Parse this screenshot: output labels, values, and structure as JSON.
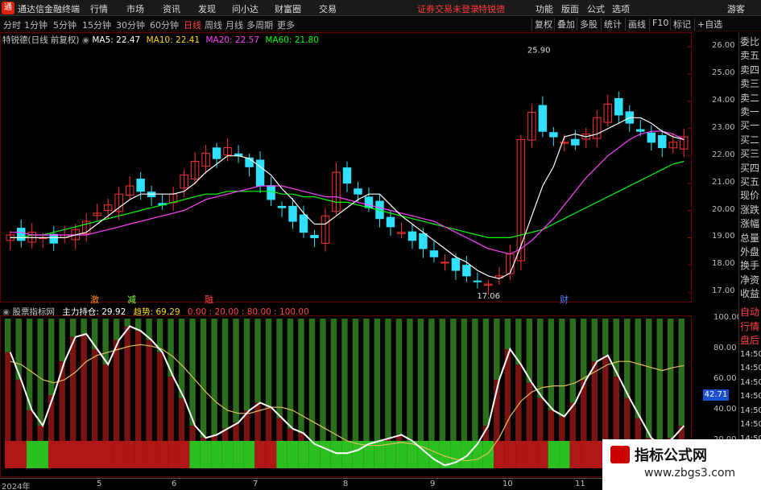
{
  "menubar": {
    "app_title": "通达信金融终端",
    "items": [
      "行情",
      "市场",
      "资讯",
      "发现",
      "问小达",
      "财富圈",
      "交易"
    ],
    "warning": "证券交易未登录",
    "stock_name": "特锐德",
    "right_items": [
      "功能",
      "版面",
      "公式",
      "选项"
    ],
    "guest": "游客",
    "logo_icon": "tdx-logo-icon"
  },
  "periodbar": {
    "periods": [
      "分时",
      "1分钟",
      "5分钟",
      "15分钟",
      "30分钟",
      "60分钟",
      "日线",
      "周线",
      "月线",
      "多周期",
      "更多"
    ],
    "active_period": "日线",
    "tools": [
      "复权",
      "叠加",
      "多股",
      "统计",
      "画线",
      "F10",
      "标记",
      "+自选"
    ]
  },
  "stockinfo": {
    "label": "特锐德(日线 前复权)",
    "ma5": "MA5: 22.47",
    "ma10": "MA10: 22.41",
    "ma20": "MA20: 22.57",
    "ma60": "MA60: 21.80",
    "colors": {
      "ma5": "#ffffff",
      "ma10": "#ffd700",
      "ma20": "#ff40ff",
      "ma60": "#00ff00"
    }
  },
  "price_axis": [
    "26.00",
    "25.00",
    "24.00",
    "23.00",
    "22.00",
    "21.00",
    "20.00",
    "19.00",
    "18.00",
    "17.00"
  ],
  "price_annotations": {
    "high": "25.90",
    "low": "17.06"
  },
  "event_markers": [
    {
      "text": "激",
      "color": "#ff8800"
    },
    {
      "text": "减",
      "color": "#88ff44"
    },
    {
      "text": "融",
      "color": "#ff4444"
    },
    {
      "text": "财",
      "color": "#4488ff"
    }
  ],
  "indicator": {
    "source": "股票指标网",
    "main_label": "主力持仓: 29.92",
    "trend_label": "趋势: 69.29",
    "levels": "0.00 : 20.00 : 80.00 : 100.00",
    "axis": [
      "100.00",
      "80.00",
      "60.00",
      "40.00",
      "20.00"
    ],
    "current_value": "42.71"
  },
  "sidebar": {
    "items": [
      "委比",
      "卖五",
      "卖四",
      "卖三",
      "卖二",
      "卖一",
      "买一",
      "买二",
      "买三",
      "买四",
      "买五",
      "现价",
      "涨跌",
      "涨幅",
      "总量",
      "外盘",
      "换手",
      "净资",
      "收益",
      "自动",
      "行情",
      "盘后",
      "14:50",
      "14:50",
      "14:50",
      "14:50",
      "14:50",
      "14:50",
      "14:50"
    ]
  },
  "timeaxis": {
    "labels": [
      "2024年",
      "5",
      "6",
      "7",
      "8",
      "9",
      "10",
      "11"
    ]
  },
  "watermark": {
    "title": "指标公式网",
    "url": "www.zbgs3.com"
  },
  "chart_data": {
    "type": "candlestick",
    "closes": [
      19.1,
      18.9,
      19.2,
      19.0,
      18.8,
      19.1,
      19.3,
      19.6,
      19.9,
      20.2,
      20.6,
      20.9,
      20.7,
      20.5,
      20.2,
      20.6,
      21.3,
      21.8,
      22.1,
      21.9,
      22.3,
      22.0,
      21.6,
      20.9,
      20.4,
      20.1,
      19.6,
      19.2,
      19.0,
      19.8,
      21.4,
      21.0,
      20.6,
      20.1,
      19.7,
      19.4,
      19.2,
      18.9,
      18.6,
      18.3,
      18.1,
      17.8,
      17.6,
      17.4,
      17.3,
      17.6,
      18.4,
      22.6,
      23.6,
      22.9,
      22.7,
      22.5,
      22.4,
      22.8,
      23.4,
      23.9,
      23.5,
      23.2,
      22.9,
      22.5,
      22.3,
      22.5,
      22.7
    ],
    "ma5": [
      19.0,
      19.0,
      19.0,
      19.0,
      19.0,
      19.0,
      19.1,
      19.2,
      19.5,
      19.8,
      20.1,
      20.4,
      20.6,
      20.6,
      20.6,
      20.6,
      20.7,
      21.0,
      21.4,
      21.7,
      22.0,
      22.0,
      21.9,
      21.6,
      21.3,
      20.8,
      20.4,
      19.9,
      19.5,
      19.5,
      19.8,
      20.1,
      20.4,
      20.6,
      20.6,
      20.2,
      19.8,
      19.5,
      19.2,
      18.9,
      18.6,
      18.3,
      18.1,
      17.8,
      17.6,
      17.5,
      17.7,
      18.7,
      19.8,
      20.9,
      21.6,
      22.7,
      22.8,
      22.7,
      22.8,
      23.0,
      23.2,
      23.4,
      23.4,
      23.2,
      22.9,
      22.7,
      22.6
    ],
    "ma20": [
      19.2,
      19.2,
      19.1,
      19.1,
      19.1,
      19.1,
      19.1,
      19.1,
      19.2,
      19.3,
      19.4,
      19.5,
      19.6,
      19.7,
      19.8,
      19.9,
      20.0,
      20.2,
      20.4,
      20.5,
      20.6,
      20.7,
      20.8,
      20.9,
      20.9,
      20.9,
      20.8,
      20.7,
      20.6,
      20.5,
      20.5,
      20.4,
      20.3,
      20.2,
      20.1,
      20.0,
      19.9,
      19.8,
      19.7,
      19.6,
      19.4,
      19.2,
      19.0,
      18.8,
      18.6,
      18.5,
      18.4,
      18.6,
      18.9,
      19.3,
      19.7,
      20.2,
      20.7,
      21.2,
      21.6,
      22.0,
      22.3,
      22.6,
      22.8,
      22.9,
      22.9,
      22.8,
      22.6
    ],
    "ma60": [
      19.0,
      19.0,
      19.1,
      19.1,
      19.2,
      19.3,
      19.4,
      19.5,
      19.6,
      19.7,
      19.8,
      19.9,
      20.0,
      20.1,
      20.2,
      20.3,
      20.4,
      20.5,
      20.6,
      20.6,
      20.7,
      20.7,
      20.7,
      20.7,
      20.7,
      20.6,
      20.6,
      20.5,
      20.5,
      20.4,
      20.3,
      20.3,
      20.2,
      20.1,
      20.0,
      19.9,
      19.8,
      19.7,
      19.6,
      19.5,
      19.4,
      19.3,
      19.2,
      19.1,
      19.0,
      19.0,
      19.0,
      19.1,
      19.2,
      19.3,
      19.5,
      19.7,
      19.9,
      20.1,
      20.3,
      20.5,
      20.7,
      20.9,
      21.1,
      21.3,
      21.5,
      21.7,
      21.8
    ],
    "indicator_main": [
      78,
      60,
      40,
      30,
      50,
      72,
      88,
      90,
      80,
      70,
      86,
      95,
      92,
      86,
      78,
      62,
      48,
      30,
      22,
      24,
      28,
      32,
      40,
      45,
      42,
      35,
      28,
      25,
      18,
      15,
      12,
      12,
      14,
      18,
      20,
      22,
      24,
      20,
      14,
      8,
      4,
      6,
      10,
      18,
      30,
      60,
      80,
      70,
      58,
      48,
      40,
      36,
      45,
      60,
      72,
      76,
      62,
      48,
      35,
      22,
      16,
      22,
      29.92
    ],
    "indicator_trend": [
      72,
      70,
      65,
      60,
      58,
      60,
      65,
      72,
      76,
      78,
      80,
      82,
      83,
      82,
      80,
      75,
      68,
      60,
      52,
      45,
      40,
      38,
      38,
      40,
      42,
      42,
      40,
      36,
      32,
      28,
      24,
      20,
      18,
      17,
      17,
      18,
      19,
      18,
      16,
      13,
      10,
      8,
      7,
      8,
      12,
      22,
      36,
      46,
      52,
      55,
      56,
      56,
      58,
      62,
      66,
      70,
      72,
      72,
      70,
      68,
      66,
      68,
      69.29
    ],
    "ylim_price": [
      16.8,
      26.3
    ],
    "ylim_indicator": [
      0,
      100
    ]
  }
}
